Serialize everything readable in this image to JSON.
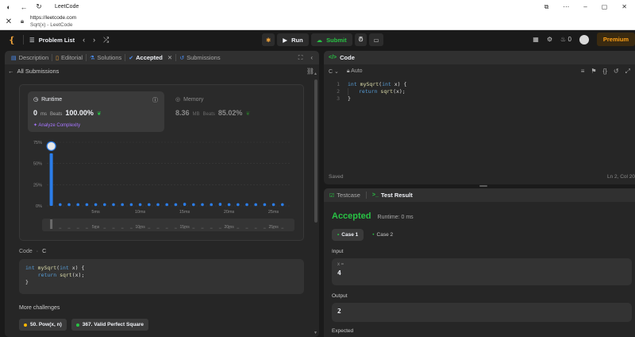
{
  "browser": {
    "tab_title": "LeetCode",
    "url": "https://leetcode.com",
    "page_title": "Sqrt(x) - LeetCode"
  },
  "navbar": {
    "problem_list": "Problem List",
    "run_label": "Run",
    "submit_label": "Submit",
    "streak_count": "0",
    "premium_label": "Premium"
  },
  "left_tabs": [
    {
      "label": "Description"
    },
    {
      "label": "Editorial"
    },
    {
      "label": "Solutions"
    },
    {
      "label": "Accepted"
    },
    {
      "label": "Submissions"
    }
  ],
  "all_submissions": "All Submissions",
  "runtime": {
    "title": "Runtime",
    "value": "0",
    "unit": "ms",
    "beats_label": "Beats",
    "beats_value": "100.00%",
    "analyze": "Analyze Complexity"
  },
  "memory": {
    "title": "Memory",
    "value": "8.36",
    "unit": "MB",
    "beats_label": "Beats",
    "beats_value": "85.02%"
  },
  "chart_data": {
    "type": "bar",
    "y_ticks": [
      "75%",
      "50%",
      "25%",
      "0%"
    ],
    "ylim": [
      0,
      75
    ],
    "x_ticks": [
      "5ms",
      "10ms",
      "15ms",
      "20ms",
      "25ms"
    ],
    "x_tick_values": [
      5,
      10,
      15,
      20,
      25
    ],
    "xlim": [
      -0.5,
      27
    ],
    "x": [
      0,
      1,
      2,
      3,
      4,
      5,
      6,
      7,
      8,
      9,
      10,
      11,
      12,
      13,
      14,
      15,
      16,
      17,
      18,
      19,
      20,
      21,
      22,
      23,
      24,
      25,
      26
    ],
    "values": [
      62,
      1.5,
      1.5,
      1.5,
      1.5,
      1.5,
      1.5,
      1.5,
      1.5,
      1.5,
      1.5,
      1.5,
      1.5,
      1.5,
      1.5,
      2,
      1.5,
      1.5,
      1.5,
      2,
      1.5,
      1.5,
      1.5,
      1.5,
      1.5,
      1.5,
      1.5
    ],
    "highlight_index": 0,
    "grid": true,
    "bar_color": "#2b7de9",
    "mini_x_ticks": [
      "5ms",
      "10ms",
      "15ms",
      "20ms",
      "25ms"
    ]
  },
  "code_section": {
    "label": "Code",
    "lang": "C",
    "lines": [
      "int mySqrt(int x) {",
      "    return sqrt(x);",
      "}"
    ]
  },
  "more_challenges": {
    "title": "More challenges",
    "items": [
      {
        "label": "50. Pow(x, n)",
        "color": "#ffb800"
      },
      {
        "label": "367. Valid Perfect Square",
        "color": "#28c244"
      }
    ]
  },
  "editor": {
    "title": "Code",
    "language": "C",
    "mode": "Auto",
    "line_numbers": [
      "1",
      "2",
      "3"
    ],
    "status": "Saved",
    "cursor": "Ln 2, Col 20"
  },
  "test": {
    "tab_testcase": "Testcase",
    "tab_result": "Test Result",
    "verdict": "Accepted",
    "runtime_text": "Runtime: 0 ms",
    "cases": [
      "Case 1",
      "Case 2"
    ],
    "input_label": "Input",
    "input_key": "x =",
    "input_value": "4",
    "output_label": "Output",
    "output_value": "2",
    "expected_label": "Expected"
  }
}
